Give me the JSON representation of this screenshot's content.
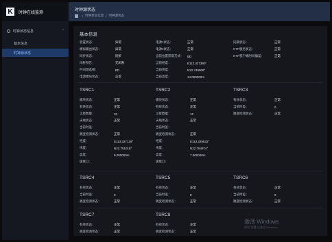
{
  "app": {
    "title": "时钟在线监测",
    "logo_text": "K"
  },
  "sidebar": {
    "group_label": "时钟状态信息",
    "items": [
      {
        "label": "基本信息"
      },
      {
        "label": "时钟源状态"
      }
    ]
  },
  "header": {
    "page_title": "时钟源状态",
    "breadcrumb": [
      "时钟状态信息",
      "时钟源状态"
    ]
  },
  "basic": {
    "title": "基本信息",
    "rows": [
      [
        {
          "label": "装置状态：",
          "value": "异常"
        },
        {
          "label": "电源1状态：",
          "value": "正常"
        },
        {
          "label": "同期状态：",
          "value": "正常"
        }
      ],
      [
        {
          "label": "模拟输出状态：",
          "value": "异常"
        },
        {
          "label": "电源2状态：",
          "value": "正常"
        },
        {
          "label": "NTP服务状态：",
          "value": "正常"
        }
      ],
      [
        {
          "label": "同步状态：",
          "value": "同步"
        },
        {
          "label": "当前位置获取方式：",
          "value": "BD"
        },
        {
          "label": "NTP客户端时间偏差：",
          "value": "正常"
        }
      ],
      [
        {
          "label": "闰秒预告：",
          "value": "无闰秒"
        },
        {
          "label": "当前经度：",
          "value": "E113.327390°"
        },
        {
          "label": "",
          "value": ""
        }
      ],
      [
        {
          "label": "时间源选择：",
          "value": "BD"
        },
        {
          "label": "当前纬度：",
          "value": "N22.749908°"
        },
        {
          "label": "",
          "value": ""
        }
      ],
      [
        {
          "label": "电源模块状态：",
          "value": "正常"
        },
        {
          "label": "当前高度：",
          "value": "14.000000m"
        },
        {
          "label": "",
          "value": ""
        }
      ]
    ]
  },
  "tsrc": [
    {
      "name": "TSRC1",
      "rows": [
        {
          "label": "模块状态：",
          "value": "正常"
        },
        {
          "label": "有效状态：",
          "value": "正常"
        },
        {
          "label": "卫星数量：",
          "value": "10"
        },
        {
          "label": "天线状态：",
          "value": "正常"
        },
        {
          "label": "当前时差：",
          "value": ""
        },
        {
          "label": "跳变检测状态：",
          "value": "正常"
        },
        {
          "label": "经度：",
          "value": "E113.327128°"
        },
        {
          "label": "纬度：",
          "value": "N22.751018°"
        },
        {
          "label": "高度：",
          "value": "9.000000m"
        },
        {
          "label": "级联口：",
          "value": ""
        }
      ]
    },
    {
      "name": "TSRC2",
      "rows": [
        {
          "label": "模块状态：",
          "value": "正常"
        },
        {
          "label": "有效状态：",
          "value": "正常"
        },
        {
          "label": "卫星数量：",
          "value": "12"
        },
        {
          "label": "天线状态：",
          "value": "正常"
        },
        {
          "label": "当前时差：",
          "value": ""
        },
        {
          "label": "跳变检测状态：",
          "value": "正常"
        },
        {
          "label": "经度：",
          "value": "E113.329532°"
        },
        {
          "label": "纬度：",
          "value": "N22.754874°"
        },
        {
          "label": "高度：",
          "value": "7.000000m"
        },
        {
          "label": "级联口：",
          "value": ""
        }
      ]
    },
    {
      "name": "TSRC3",
      "rows": [
        {
          "label": "有效状态：",
          "value": "正常"
        },
        {
          "label": "当前时差：",
          "value": "0"
        },
        {
          "label": "跳变检测状态：",
          "value": "正常"
        }
      ]
    },
    {
      "name": "TSRC4",
      "rows": [
        {
          "label": "有效状态：",
          "value": "正常"
        },
        {
          "label": "当前时差：",
          "value": "0"
        },
        {
          "label": "跳变检测状态：",
          "value": "正常"
        }
      ]
    },
    {
      "name": "TSRC5",
      "rows": [
        {
          "label": "有效状态：",
          "value": "正常"
        },
        {
          "label": "当前时差：",
          "value": "0"
        },
        {
          "label": "跳变检测状态：",
          "value": "正常"
        }
      ]
    },
    {
      "name": "TSRC6",
      "rows": [
        {
          "label": "有效状态：",
          "value": "正常"
        },
        {
          "label": "当前时差：",
          "value": "0"
        },
        {
          "label": "跳变检测状态：",
          "value": "正常"
        }
      ]
    },
    {
      "name": "TSRC7",
      "rows": [
        {
          "label": "有效状态：",
          "value": "正常"
        },
        {
          "label": "跳变检测状态：",
          "value": "正常"
        }
      ]
    },
    {
      "name": "TSRC8",
      "rows": [
        {
          "label": "有效状态：",
          "value": "正常"
        },
        {
          "label": "跳变检测状态：",
          "value": "正常"
        }
      ]
    }
  ],
  "watermark": {
    "title": "激活 Windows",
    "subtitle": "转到\"设置\"以激活 Windows。"
  }
}
